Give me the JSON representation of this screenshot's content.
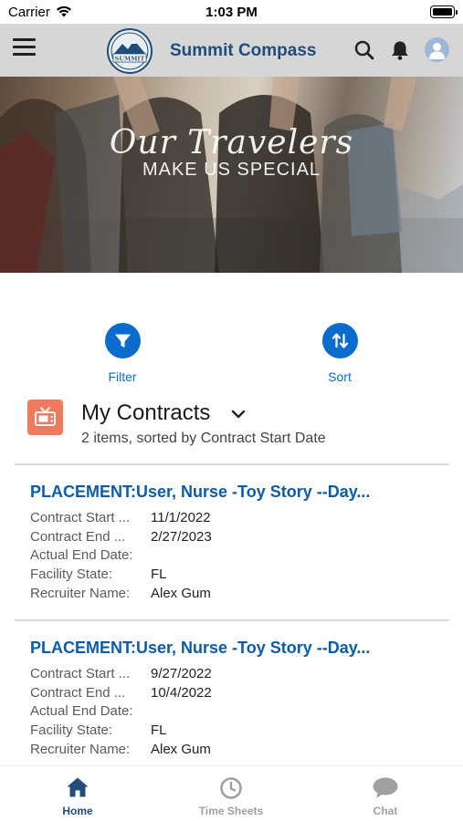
{
  "status_bar": {
    "carrier": "Carrier",
    "time": "1:03 PM"
  },
  "header": {
    "app_title": "Summit Compass",
    "logo_text": "SUMMIT COMPASS",
    "icons": [
      "menu-icon",
      "search-icon",
      "bell-icon",
      "avatar-icon"
    ]
  },
  "hero": {
    "line1": "Our Travelers",
    "line2": "MAKE US SPECIAL"
  },
  "actions": {
    "filter_label": "Filter",
    "sort_label": "Sort"
  },
  "list": {
    "title": "My Contracts",
    "subtitle": "2 items, sorted by Contract Start Date"
  },
  "records": [
    {
      "title": "PLACEMENT:User, Nurse -Toy Story --Day...",
      "fields": [
        {
          "label": "Contract Start ...",
          "value": "11/1/2022"
        },
        {
          "label": "Contract End ...",
          "value": "2/27/2023"
        },
        {
          "label": "Actual End Date:",
          "value": ""
        },
        {
          "label": "Facility State:",
          "value": "FL"
        },
        {
          "label": "Recruiter Name:",
          "value": "Alex Gum"
        }
      ]
    },
    {
      "title": "PLACEMENT:User, Nurse -Toy Story --Day...",
      "fields": [
        {
          "label": "Contract Start ...",
          "value": "9/27/2022"
        },
        {
          "label": "Contract End ...",
          "value": "10/4/2022"
        },
        {
          "label": "Actual End Date:",
          "value": ""
        },
        {
          "label": "Facility State:",
          "value": "FL"
        },
        {
          "label": "Recruiter Name:",
          "value": "Alex Gum"
        }
      ]
    }
  ],
  "bottom_nav": {
    "home": "Home",
    "time_sheets": "Time Sheets",
    "chat": "Chat",
    "active": "home"
  },
  "colors": {
    "brand": "#1f4e79",
    "accent": "#0b6cce",
    "list_icon": "#ef7a5e",
    "header_bg": "#d6d6d6"
  }
}
